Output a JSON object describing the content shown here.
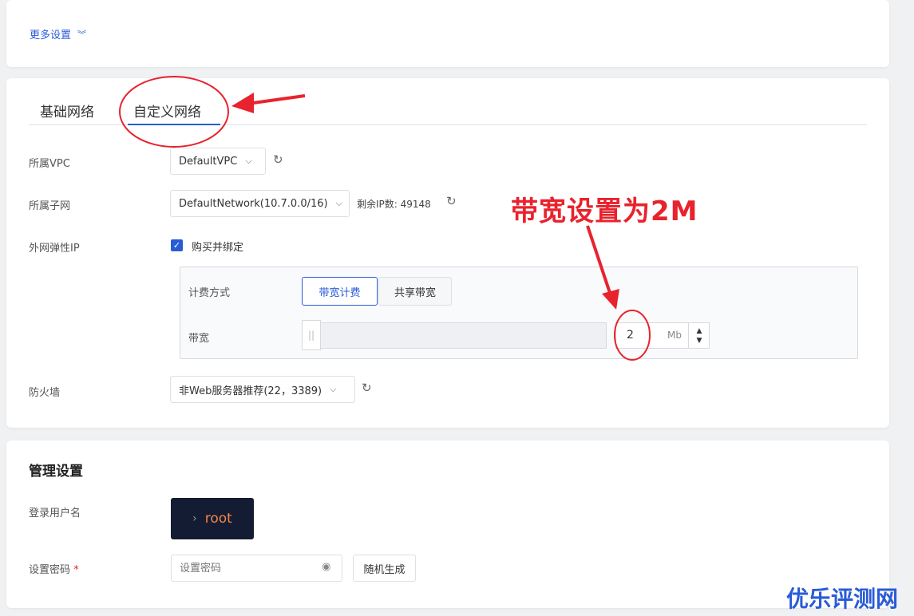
{
  "more_settings": {
    "label": "更多设置",
    "chevron_icon": "double-chevron-down-icon"
  },
  "network": {
    "tabs": [
      {
        "label": "基础网络"
      },
      {
        "label": "自定义网络"
      }
    ],
    "active_tab": "自定义网络",
    "vpc": {
      "label": "所属VPC",
      "value": "DefaultVPC"
    },
    "subnet": {
      "label": "所属子网",
      "value": "DefaultNetwork(10.7.0.0/16)",
      "remaining": "剩余IP数: 49148"
    },
    "eip": {
      "label": "外网弹性IP",
      "checkbox_label": "购买并绑定",
      "checked": true
    },
    "billing": {
      "label": "计费方式",
      "options": [
        "带宽计费",
        "共享带宽"
      ],
      "selected": "带宽计费"
    },
    "bandwidth": {
      "label": "带宽",
      "value": "2",
      "unit": "Mb",
      "slider_level": 0.0
    },
    "firewall": {
      "label": "防火墙",
      "value": "非Web服务器推荐(22，3389)"
    }
  },
  "management": {
    "title": "管理设置",
    "username": {
      "label": "登录用户名",
      "value": "root",
      "prompt": "›"
    },
    "password": {
      "label": "设置密码",
      "required_mark": "*",
      "placeholder": "设置密码",
      "generate_button": "随机生成"
    }
  },
  "annotation": {
    "text": "带宽设置为2M",
    "color": "#e8232d"
  },
  "watermark": {
    "text": "优乐评测网",
    "color": "#2a5bd7"
  },
  "colors": {
    "accent": "#2a5bd7",
    "annotation": "#e8232d"
  }
}
